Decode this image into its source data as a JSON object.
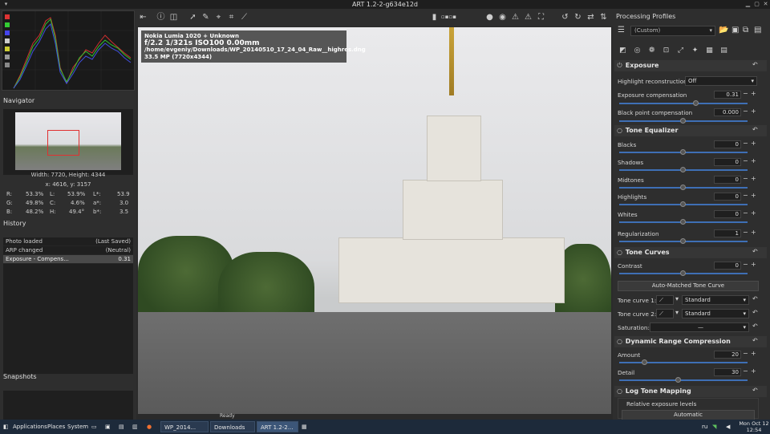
{
  "window": {
    "title": "ART 1.2-2-g634e12d"
  },
  "left": {
    "navigator_title": "Navigator",
    "image_size": "Width: 7720, Height: 4344",
    "cursor_pos": "x: 4616, y: 3157",
    "readouts": {
      "R": "53.3%",
      "G": "49.8%",
      "B": "48.2%",
      "L": "53.9%",
      "C": "4.6%",
      "H": "49.4°",
      "Lstar": "53.9",
      "astar": "3.0",
      "bstar": "3.5",
      "R_label": "R:",
      "G_label": "G:",
      "B_label": "B:",
      "L_label": "L:",
      "C_label": "C:",
      "H_label": "H:",
      "Lstar_label": "L*:",
      "astar_label": "a*:",
      "bstar_label": "b*:"
    },
    "history_title": "History",
    "history": [
      {
        "action": "Photo loaded",
        "value": "(Last Saved)"
      },
      {
        "action": "ARP changed",
        "value": "(Neutral)"
      },
      {
        "action": "Exposure - Compens...",
        "value": "0.31"
      }
    ],
    "snapshots_title": "Snapshots"
  },
  "overlay": {
    "camera": "Nokia Lumia 1020 + Unknown",
    "exif": "f/2.2  1/321s  ISO100  0.00mm",
    "path": "/home/evgeniy/Downloads/WP_20140510_17_24_04_Raw__highres.dng",
    "mp": "33.5 MP (7720x4344)"
  },
  "right": {
    "title": "Processing Profiles",
    "profile": "(Custom)",
    "exposure": {
      "header": "Exposure",
      "highlight_label": "Highlight reconstruction:",
      "highlight_value": "Off",
      "comp_label": "Exposure compensation",
      "comp_value": "0.31",
      "comp_level": 0.6,
      "black_label": "Black point compensation",
      "black_value": "0.000",
      "black_level": 0.5
    },
    "tone_eq": {
      "header": "Tone Equalizer",
      "rows": [
        {
          "label": "Blacks",
          "value": "0",
          "level": 0.5
        },
        {
          "label": "Shadows",
          "value": "0",
          "level": 0.5
        },
        {
          "label": "Midtones",
          "value": "0",
          "level": 0.5
        },
        {
          "label": "Highlights",
          "value": "0",
          "level": 0.5
        },
        {
          "label": "Whites",
          "value": "0",
          "level": 0.5
        }
      ],
      "reg_label": "Regularization",
      "reg_value": "1",
      "reg_level": 0.5
    },
    "tone_curves": {
      "header": "Tone Curves",
      "contrast_label": "Contrast",
      "contrast_value": "0",
      "contrast_level": 0.5,
      "auto_btn": "Auto-Matched Tone Curve",
      "curve1_label": "Tone curve 1:",
      "curve1_value": "Standard",
      "curve2_label": "Tone curve 2:",
      "curve2_value": "Standard",
      "sat_label": "Saturation:",
      "sat_value": "—"
    },
    "drc": {
      "header": "Dynamic Range Compression",
      "amount_label": "Amount",
      "amount_value": "20",
      "amount_level": 0.2,
      "detail_label": "Detail",
      "detail_value": "30",
      "detail_level": 0.46
    },
    "ltm": {
      "header": "Log Tone Mapping",
      "rel_label": "Relative exposure levels",
      "auto_value": "Automatic"
    }
  },
  "statusbar": {
    "ready": "Ready"
  },
  "taskbar": {
    "applications": "Applications",
    "places": "Places",
    "system": "System",
    "win1": "WP_2014...",
    "win2": "Downloads",
    "win3": "ART 1.2-2...",
    "lang": "ru",
    "date": "Mon Oct 12",
    "time": "12:54"
  }
}
